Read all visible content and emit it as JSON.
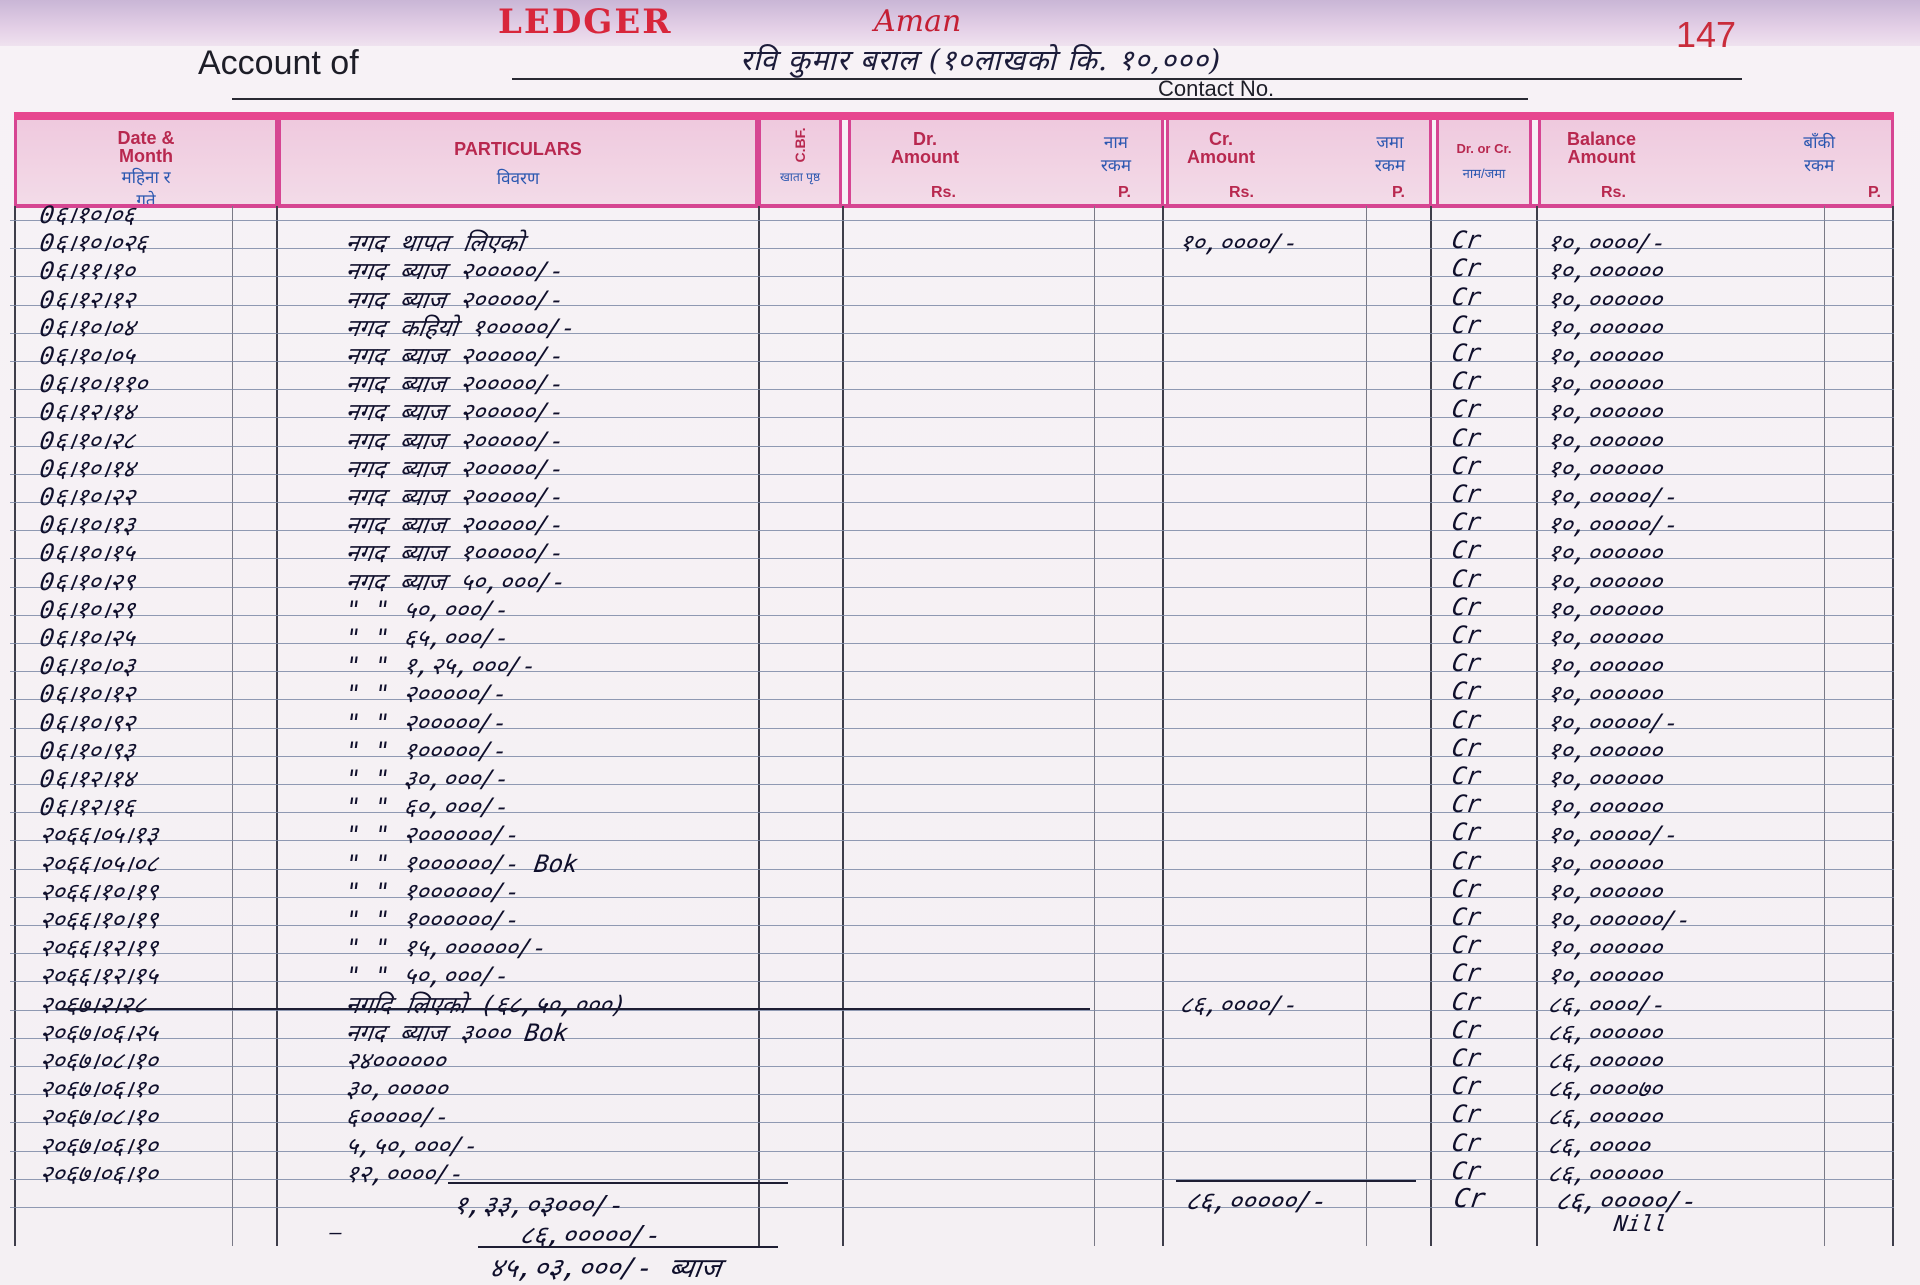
{
  "header": {
    "brand": "LEDGER",
    "brand_sub": "Aman",
    "page_number": "147",
    "account_of_label": "Account of",
    "account_of_value": "रवि कुमार बराल (१०लाखको कि. १०,०००)",
    "contact_label": "Contact No."
  },
  "columns": {
    "date": {
      "en1": "Date &",
      "en2": "Month",
      "np1": "महिना र",
      "np2": "गते"
    },
    "particulars": {
      "en": "PARTICULARS",
      "np": "विवरण"
    },
    "cbf": {
      "en": "C.BF.",
      "np": "खाता पृष्ठ"
    },
    "dr": {
      "en1": "Dr.",
      "en2": "Amount",
      "np1": "नाम",
      "np2": "रकम",
      "rs": "Rs.",
      "p": "P."
    },
    "cr": {
      "en1": "Cr.",
      "en2": "Amount",
      "np1": "जमा",
      "np2": "रकम",
      "rs": "Rs.",
      "p": "P."
    },
    "drcr": {
      "en": "Dr. or Cr.",
      "np": "नाम/जमा"
    },
    "balance": {
      "en1": "Balance",
      "en2": "Amount",
      "np1": "बाँकी",
      "np2": "रकम",
      "rs": "Rs.",
      "p": "P."
    }
  },
  "rows": [
    {
      "date": "0६।१०।०६",
      "part": "",
      "cr": "",
      "drcr": "",
      "bal": ""
    },
    {
      "date": "0६।१०।०२६",
      "part": "नगद थापत लिएको",
      "cr": "१०,००००/-",
      "drcr": "Cr",
      "bal": "१०,००००/-"
    },
    {
      "date": "0६।११।१०",
      "part": "नगद ब्याज २०००००/-",
      "cr": "",
      "drcr": "Cr",
      "bal": "१०,००००००"
    },
    {
      "date": "0६।१२।१२",
      "part": "नगद ब्याज २०००००/-",
      "cr": "",
      "drcr": "Cr",
      "bal": "१०,००००००"
    },
    {
      "date": "0६।१०।०४",
      "part": "नगद कहियो १०००००/-",
      "cr": "",
      "drcr": "Cr",
      "bal": "१०,००००००"
    },
    {
      "date": "0६।१०।०५",
      "part": "नगद ब्याज २०००००/-",
      "cr": "",
      "drcr": "Cr",
      "bal": "१०,००००००"
    },
    {
      "date": "0६।१०।११०",
      "part": "नगद ब्याज २०००००/-",
      "cr": "",
      "drcr": "Cr",
      "bal": "१०,००००००"
    },
    {
      "date": "0६।१२।१४",
      "part": "नगद ब्याज २०००००/-",
      "cr": "",
      "drcr": "Cr",
      "bal": "१०,००००००"
    },
    {
      "date": "0६।१०।२८",
      "part": "नगद ब्याज २०००००/-",
      "cr": "",
      "drcr": "Cr",
      "bal": "१०,००००००"
    },
    {
      "date": "0६।१०।१४",
      "part": "नगद ब्याज २०००००/-",
      "cr": "",
      "drcr": "Cr",
      "bal": "१०,००००००"
    },
    {
      "date": "0६।१०।२२",
      "part": "नगद ब्याज २०००००/-",
      "cr": "",
      "drcr": "Cr",
      "bal": "१०,०००००/-"
    },
    {
      "date": "0६।१०।१३",
      "part": "नगद ब्याज २०००००/-",
      "cr": "",
      "drcr": "Cr",
      "bal": "१०,०००००/-"
    },
    {
      "date": "0६।१०।१५",
      "part": "नगद ब्याज १०००००/-",
      "cr": "",
      "drcr": "Cr",
      "bal": "१०,००००००"
    },
    {
      "date": "0६।१०।२९",
      "part": "नगद ब्याज ५०,०००/-",
      "cr": "",
      "drcr": "Cr",
      "bal": "१०,००००००"
    },
    {
      "date": "0६।१०।२९",
      "part": "\"    \"     ५०,०००/-",
      "cr": "",
      "drcr": "Cr",
      "bal": "१०,००००००"
    },
    {
      "date": "0६।१०।२५",
      "part": "\"    \"     ६५,०००/-",
      "cr": "",
      "drcr": "Cr",
      "bal": "१०,००००००"
    },
    {
      "date": "0६।१०।०३",
      "part": "\"    \"     १,२५,०००/-",
      "cr": "",
      "drcr": "Cr",
      "bal": "१०,००००००"
    },
    {
      "date": "0६।१०।१२",
      "part": "\"    \"     २०००००/-",
      "cr": "",
      "drcr": "Cr",
      "bal": "१०,००००००"
    },
    {
      "date": "0६।१०।९२",
      "part": "\"    \"     २०००००/-",
      "cr": "",
      "drcr": "Cr",
      "bal": "१०,०००००/-"
    },
    {
      "date": "0६।१०।९३",
      "part": "\"    \"     १०००००/-",
      "cr": "",
      "drcr": "Cr",
      "bal": "१०,००००००"
    },
    {
      "date": "0६।१२।१४",
      "part": "\"    \"     ३०,०००/-",
      "cr": "",
      "drcr": "Cr",
      "bal": "१०,००००००"
    },
    {
      "date": "0६।१२।१६",
      "part": "\"    \"     ६०,०००/-",
      "cr": "",
      "drcr": "Cr",
      "bal": "१०,००००००"
    },
    {
      "date": "२०६६।०५।१३",
      "part": "\"    \"     २००००००/-",
      "cr": "",
      "drcr": "Cr",
      "bal": "१०,०००००/-"
    },
    {
      "date": "२०६६।०५।०८",
      "part": "\"    \"     १००००००/- Bok",
      "cr": "",
      "drcr": "Cr",
      "bal": "१०,००००००"
    },
    {
      "date": "२०६६।१०।१९",
      "part": "\"    \"     १००००००/-",
      "cr": "",
      "drcr": "Cr",
      "bal": "१०,००००००"
    },
    {
      "date": "२०६६।१०।१९",
      "part": "\"    \"     १००००००/-",
      "cr": "",
      "drcr": "Cr",
      "bal": "१०,००००००/-"
    },
    {
      "date": "२०६६।१२।१९",
      "part": "\"    \"     १५,००००००/-",
      "cr": "",
      "drcr": "Cr",
      "bal": "१०,००००००"
    },
    {
      "date": "२०६६।१२।१५",
      "part": "\"    \"     ५०,०००/-",
      "cr": "",
      "drcr": "Cr",
      "bal": "१०,००००००"
    },
    {
      "date": "२०६७।२।२८",
      "part": "नगदि लिएको  (६८,५०,०००)",
      "cr": "८६,००००/-",
      "drcr": "Cr",
      "bal": "८६,००००/-"
    },
    {
      "date": "२०६७।०६।२५",
      "part": "नगद ब्याज ३००० Bok",
      "cr": "",
      "drcr": "Cr",
      "bal": "८६,००००००"
    },
    {
      "date": "२०६७।०८।१०",
      "part": "२४००००००",
      "cr": "",
      "drcr": "Cr",
      "bal": "८६,००००००"
    },
    {
      "date": "२०६७।०६।१०",
      "part": "३०,०००००",
      "cr": "",
      "drcr": "Cr",
      "bal": "८६,००००७०"
    },
    {
      "date": "२०६७।०८।१०",
      "part": "६०००००/-",
      "cr": "",
      "drcr": "Cr",
      "bal": "८६,००००००"
    },
    {
      "date": "२०६७।०६।१०",
      "part": "५,५०,०००/-",
      "cr": "",
      "drcr": "Cr",
      "bal": "८६,०००००"
    },
    {
      "date": "२०६७।०६।१०",
      "part": "१२,००००/-",
      "cr": "",
      "drcr": "Cr",
      "bal": "८६,००००००"
    }
  ],
  "totals": {
    "particulars_total": "१,३३,०३०००/-",
    "cr_total": "८६,०००००/-",
    "drcr": "Cr",
    "bal_total": "८६,०००००/-",
    "nil": "Nill",
    "less": "८६,०००००/-",
    "net_interest": "४५,०३,०००/- ब्याज"
  }
}
